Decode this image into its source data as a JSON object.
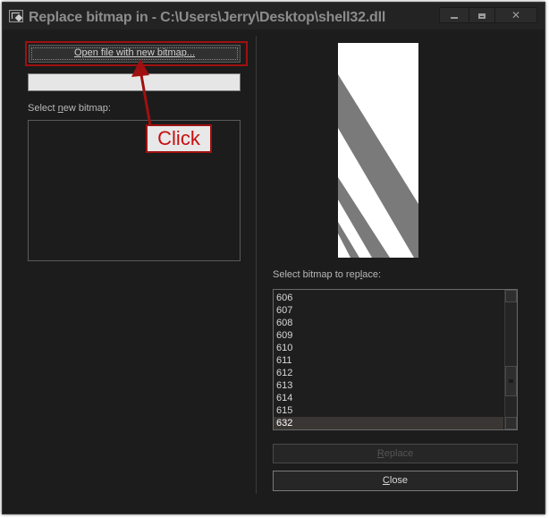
{
  "window": {
    "title": "Replace bitmap in - C:\\Users\\Jerry\\Desktop\\shell32.dll"
  },
  "left": {
    "open_button": "Open file with new bitmap...",
    "path_value": "",
    "select_new_label_pre": "Select ",
    "select_new_label_key": "n",
    "select_new_label_post": "ew bitmap:"
  },
  "right": {
    "select_replace_label_pre": "Select bitmap to rep",
    "select_replace_label_key": "l",
    "select_replace_label_post": "ace:",
    "list_items": [
      "606",
      "607",
      "608",
      "609",
      "610",
      "611",
      "612",
      "613",
      "614",
      "615",
      "632"
    ],
    "selected_item": "632",
    "replace_button_pre": "",
    "replace_button_key": "R",
    "replace_button_post": "eplace",
    "close_button_pre": "",
    "close_button_key": "C",
    "close_button_post": "lose"
  },
  "annotation": {
    "callout_text": "Click"
  },
  "colors": {
    "window_bg": "#1c1c1c",
    "annotation_red": "#a01010",
    "preview_stripe": "#7a7a7a"
  }
}
